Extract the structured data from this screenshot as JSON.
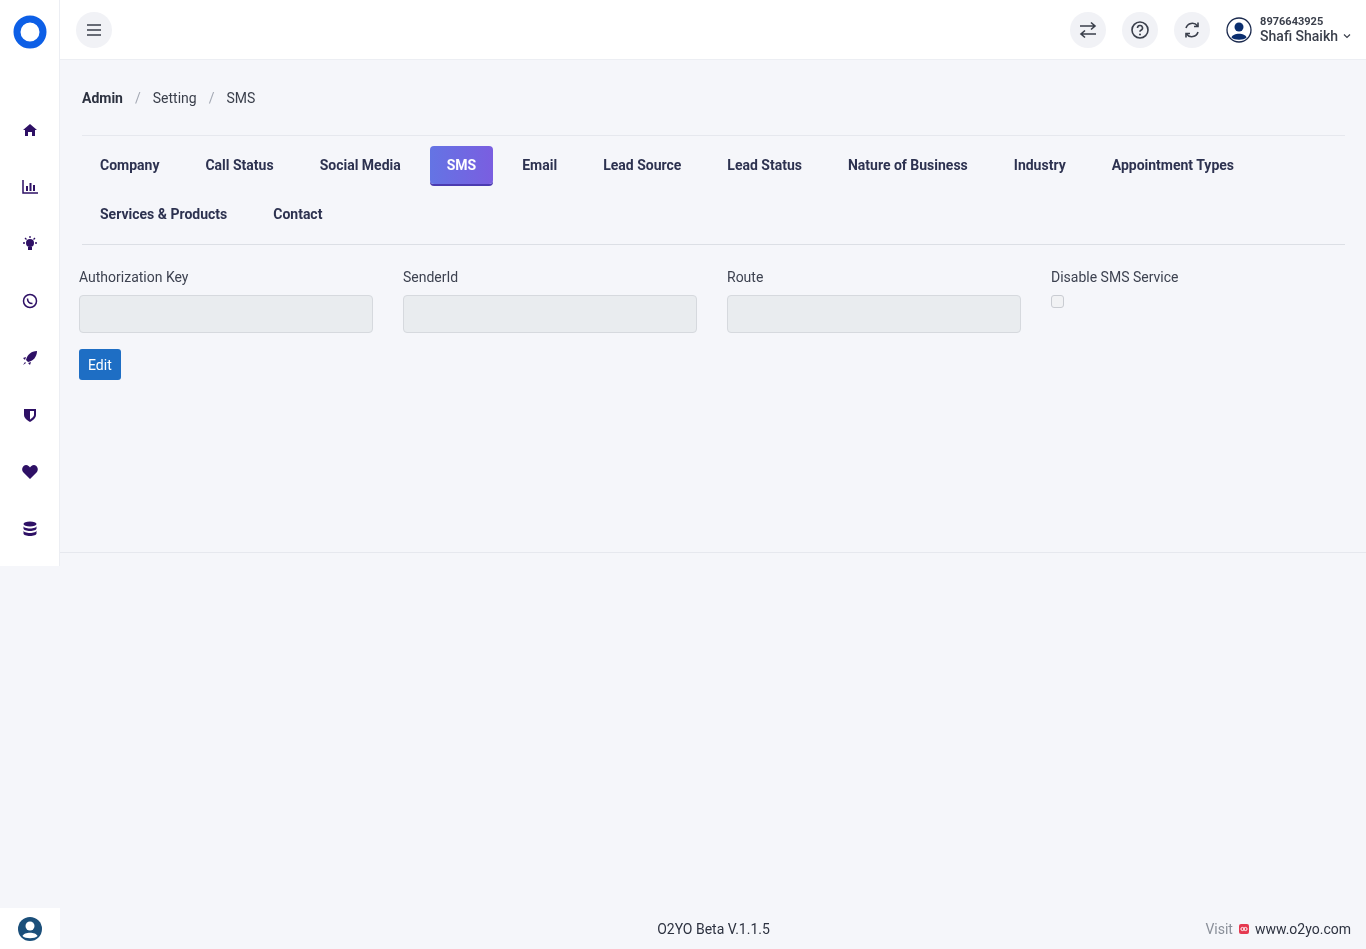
{
  "header": {
    "phone": "8976643925",
    "user_name": "Shafi Shaikh"
  },
  "breadcrumb": [
    "Admin",
    "Setting",
    "SMS"
  ],
  "breadcrumb_separator": "/",
  "tabs": [
    {
      "label": "Company",
      "selected": false
    },
    {
      "label": "Call Status",
      "selected": false
    },
    {
      "label": "Social Media",
      "selected": false
    },
    {
      "label": "SMS",
      "selected": true
    },
    {
      "label": "Email",
      "selected": false
    },
    {
      "label": "Lead Source",
      "selected": false
    },
    {
      "label": "Lead Status",
      "selected": false
    },
    {
      "label": "Nature of Business",
      "selected": false
    },
    {
      "label": "Industry",
      "selected": false
    },
    {
      "label": "Appointment Types",
      "selected": false
    },
    {
      "label": "Services & Products",
      "selected": false
    },
    {
      "label": "Contact",
      "selected": false
    }
  ],
  "form": {
    "fields": [
      {
        "label": "Authorization Key",
        "kind": "text",
        "disabled": true
      },
      {
        "label": "SenderId",
        "kind": "text",
        "disabled": true
      },
      {
        "label": "Route",
        "kind": "text",
        "disabled": true
      },
      {
        "label": "Disable SMS Service",
        "kind": "checkbox",
        "checked": false,
        "disabled": true
      }
    ],
    "button": "Edit"
  },
  "footer": {
    "version": "O2YO Beta V.1.1.5",
    "visit_label": "Visit",
    "site": "www.o2yo.com"
  }
}
